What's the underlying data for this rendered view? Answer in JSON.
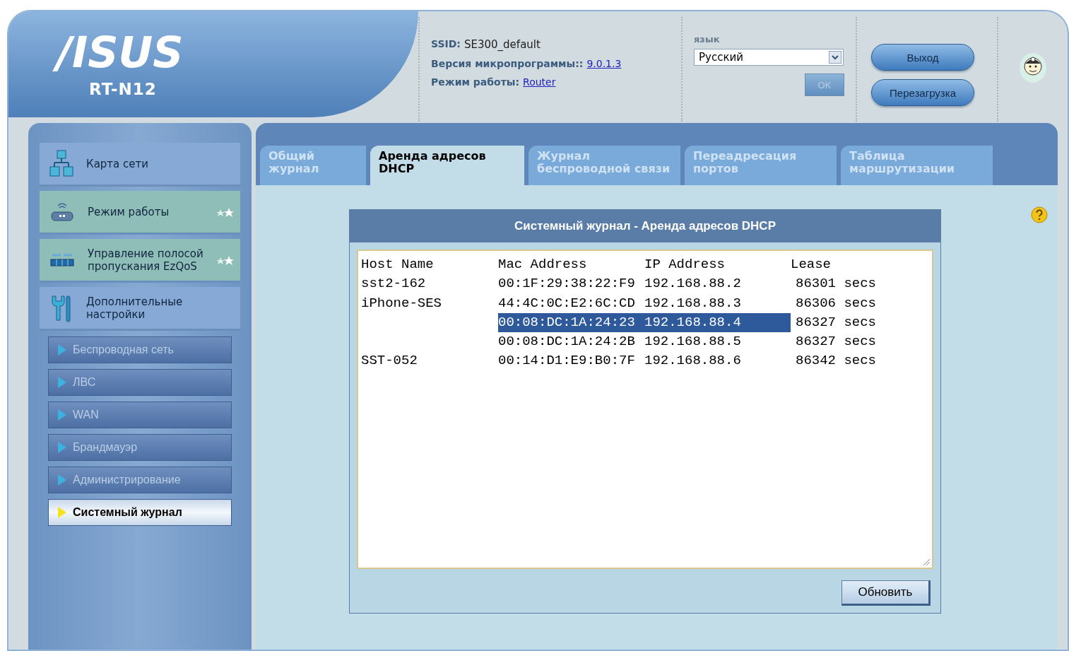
{
  "logo": {
    "brand": "/ISUS",
    "model": "RT-N12"
  },
  "info": [
    {
      "label": "SSID:",
      "value": "SE300_default",
      "link": false
    },
    {
      "label": "Версия микропрограммы::",
      "value": "9.0.1.3",
      "link": true
    },
    {
      "label": "Режим работы:",
      "value": "Router",
      "link": true
    }
  ],
  "language": {
    "label": "язык",
    "value": "Русский",
    "ok": "OK"
  },
  "buttons": [
    "Выход",
    "Перезагрузка"
  ],
  "sidebar": {
    "items": [
      {
        "kind": "main",
        "label": "Карта сети",
        "highlighted": false
      },
      {
        "kind": "main",
        "label": "Режим работы",
        "highlighted": true
      },
      {
        "kind": "main",
        "label": "Управление полосой пропускания EzQoS",
        "highlighted": true
      },
      {
        "kind": "main",
        "label": "Дополнительные настройки",
        "highlighted": false
      },
      {
        "kind": "sub",
        "label": "Беспроводная сеть",
        "selected": false
      },
      {
        "kind": "sub",
        "label": "ЛВС",
        "selected": false
      },
      {
        "kind": "sub",
        "label": "WAN",
        "selected": false
      },
      {
        "kind": "sub",
        "label": "Брандмауэр",
        "selected": false
      },
      {
        "kind": "sub",
        "label": "Администрирование",
        "selected": false
      },
      {
        "kind": "sub",
        "label": "Системный журнал",
        "selected": true
      }
    ]
  },
  "tabs": [
    {
      "label": "Общий журнал",
      "selected": false
    },
    {
      "label": "Аренда адресов DHCP",
      "selected": true
    },
    {
      "label": "Журнал беспроводной связи",
      "selected": false
    },
    {
      "label": "Переадресация портов",
      "selected": false
    },
    {
      "label": "Таблица маршрутизации",
      "selected": false
    }
  ],
  "log": {
    "title": "Системный журнал - Аренда адресов DHCP",
    "columns": [
      "Host Name",
      "Mac Address",
      "IP Address",
      "Lease"
    ],
    "rows": [
      {
        "host": "sst2-162",
        "mac": "00:1F:29:38:22:F9",
        "ip": "192.168.88.2",
        "lease": "86301 secs",
        "highlighted": false
      },
      {
        "host": "iPhone-SES",
        "mac": "44:4C:0C:E2:6C:CD",
        "ip": "192.168.88.3",
        "lease": "86306 secs",
        "highlighted": false
      },
      {
        "host": "",
        "mac": "00:08:DC:1A:24:23",
        "ip": "192.168.88.4",
        "lease": "86327 secs",
        "highlighted": true
      },
      {
        "host": "",
        "mac": "00:08:DC:1A:24:2B",
        "ip": "192.168.88.5",
        "lease": "86327 secs",
        "highlighted": false
      },
      {
        "host": "SST-052",
        "mac": "00:14:D1:E9:B0:7F",
        "ip": "192.168.88.6",
        "lease": "86342 secs",
        "highlighted": false
      }
    ],
    "refresh": "Обновить"
  }
}
